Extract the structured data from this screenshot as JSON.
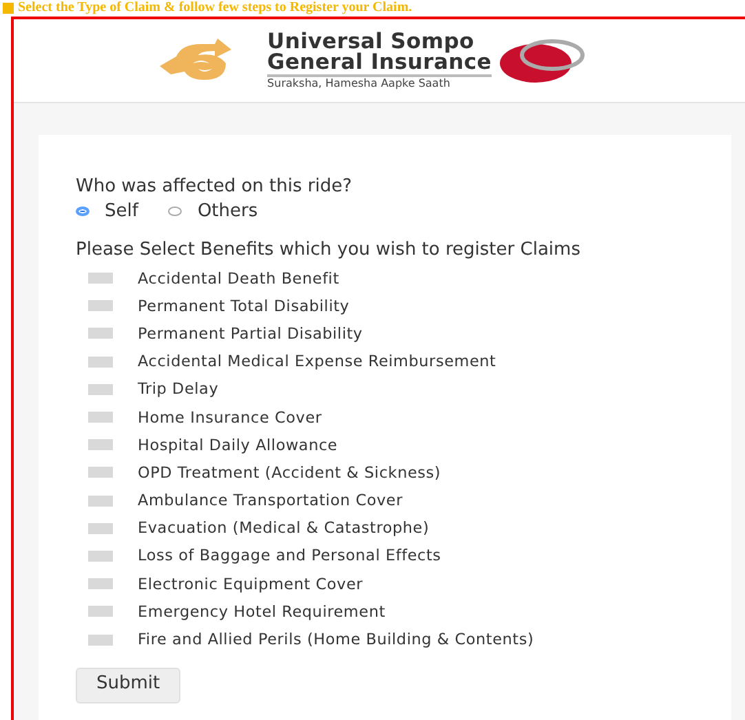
{
  "banner": {
    "text": "Select the Type of Claim & follow few steps to Register your Claim."
  },
  "logo": {
    "name_line_1": "Universal Sompo",
    "name_line_2": "General Insurance",
    "tagline": "Suraksha, Hamesha Aapke Saath"
  },
  "question": {
    "label": "Who was affected on this ride?",
    "options": [
      {
        "label": "Self",
        "selected": true
      },
      {
        "label": "Others",
        "selected": false
      }
    ]
  },
  "benefits": {
    "label": "Please Select Benefits which you wish to register Claims",
    "items": [
      {
        "label": "Accidental Death Benefit",
        "checked": false
      },
      {
        "label": "Permanent Total Disability",
        "checked": false
      },
      {
        "label": "Permanent Partial Disability",
        "checked": false
      },
      {
        "label": "Accidental Medical Expense Reimbursement",
        "checked": false
      },
      {
        "label": "Trip Delay",
        "checked": false
      },
      {
        "label": "Home Insurance Cover",
        "checked": false
      },
      {
        "label": "Hospital Daily Allowance",
        "checked": false
      },
      {
        "label": "OPD Treatment (Accident & Sickness)",
        "checked": false
      },
      {
        "label": "Ambulance Transportation Cover",
        "checked": false
      },
      {
        "label": "Evacuation (Medical & Catastrophe)",
        "checked": false
      },
      {
        "label": "Loss of Baggage and Personal Effects",
        "checked": false
      },
      {
        "label": "Electronic Equipment Cover",
        "checked": false
      },
      {
        "label": "Emergency Hotel Requirement",
        "checked": false
      },
      {
        "label": "Fire and Allied Perils (Home Building & Contents)",
        "checked": false
      }
    ]
  },
  "submit_button": {
    "label": "Submit"
  }
}
